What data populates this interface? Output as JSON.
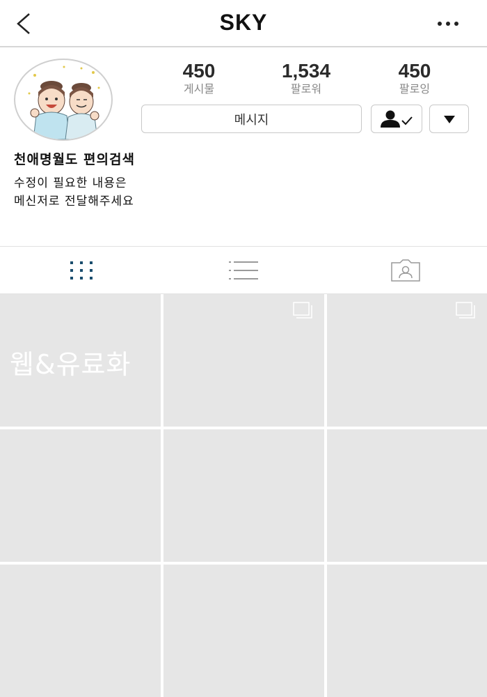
{
  "header": {
    "title": "SKY",
    "back_icon": "chevron-left-icon",
    "more_icon": "more-horizontal-icon"
  },
  "profile": {
    "avatar": "profile-avatar-illustration",
    "stats": [
      {
        "value": "450",
        "label": "게시물"
      },
      {
        "value": "1,534",
        "label": "팔로워"
      },
      {
        "value": "450",
        "label": "팔로잉"
      }
    ],
    "message_button": "메시지",
    "follow_icon": "person-check-icon",
    "dropdown_icon": "triangle-down-icon",
    "name": "천애명월도 편의검색",
    "bio_lines": [
      "수정이 필요한 내용은",
      "메신저로 전달해주세요"
    ]
  },
  "tabs": [
    {
      "icon": "grid-icon",
      "active": true
    },
    {
      "icon": "list-icon",
      "active": false
    },
    {
      "icon": "tagged-person-icon",
      "active": false
    }
  ],
  "posts": [
    {
      "label": "웹&유료화",
      "multi": false
    },
    {
      "label": "",
      "multi": true
    },
    {
      "label": "",
      "multi": true
    },
    {
      "label": "",
      "multi": false
    },
    {
      "label": "",
      "multi": false
    },
    {
      "label": "",
      "multi": false
    },
    {
      "label": "",
      "multi": false
    },
    {
      "label": "",
      "multi": false
    },
    {
      "label": "",
      "multi": false
    }
  ],
  "colors": {
    "accent": "#1a4d6e",
    "cell_bg": "#e6e6e6",
    "divider": "#d6d6d6"
  }
}
